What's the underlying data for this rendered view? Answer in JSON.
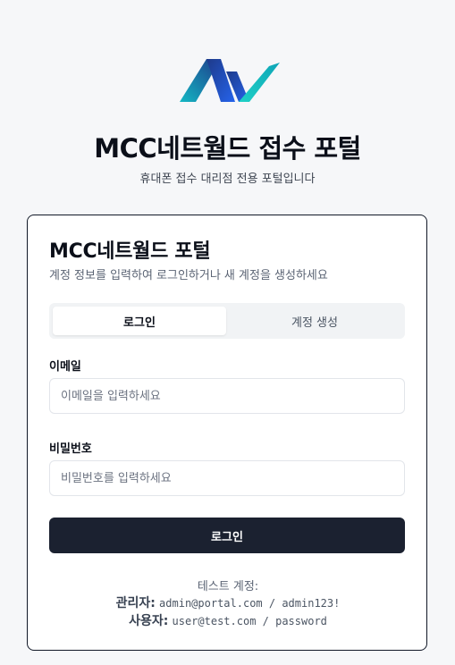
{
  "brand": {
    "logo_icon": "mcc-network-logo-icon",
    "title": "MCC네트월드 접수 포털",
    "subtitle": "휴대폰 접수 대리점 전용 포털입니다",
    "colors": {
      "logo_dark": "#1e3a8a",
      "logo_light": "#14b8c4"
    }
  },
  "card": {
    "title": "MCC네트월드 포털",
    "description": "계정 정보를 입력하여 로그인하거나 새 계정을 생성하세요",
    "tabs": [
      {
        "label": "로그인",
        "active": true
      },
      {
        "label": "계정 생성",
        "active": false
      }
    ],
    "email": {
      "label": "이메일",
      "placeholder": "이메일을 입력하세요",
      "value": ""
    },
    "password": {
      "label": "비밀번호",
      "placeholder": "비밀번호를 입력하세요",
      "value": ""
    },
    "login_button": "로그인",
    "test_accounts": {
      "heading": "테스트 계정:",
      "admin_role": "관리자:",
      "admin_cred": "admin@portal.com / admin123!",
      "user_role": "사용자:",
      "user_cred": "user@test.com / password"
    }
  },
  "colors": {
    "background": "#f6f7f9",
    "primary_button": "#1b2130",
    "card_border": "#111827"
  }
}
